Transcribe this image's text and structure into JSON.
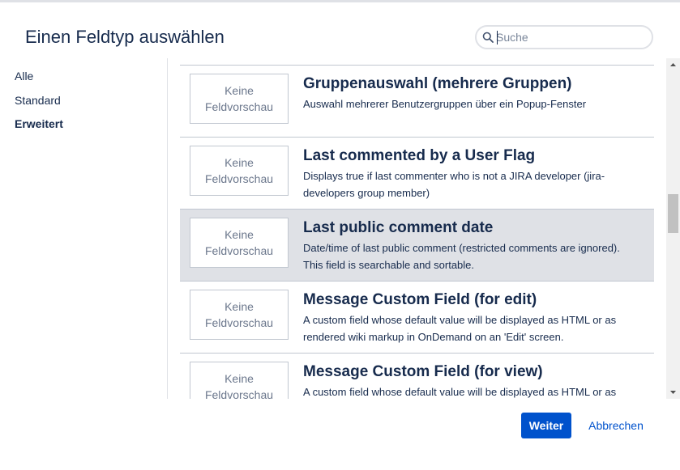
{
  "dialog": {
    "title": "Einen Feldtyp auswählen"
  },
  "search": {
    "placeholder": "Suche",
    "value": "",
    "icon": "search-icon"
  },
  "nav": {
    "items": [
      {
        "label": "Alle",
        "active": false
      },
      {
        "label": "Standard",
        "active": false
      },
      {
        "label": "Erweitert",
        "active": true
      }
    ]
  },
  "fields": [
    {
      "preview": "Keine Feldvorschau",
      "title": "Gruppenauswahl (mehrere Gruppen)",
      "description": "Auswahl mehrerer Benutzergruppen über ein Popup-Fenster",
      "selected": false
    },
    {
      "preview": "Keine Feldvorschau",
      "title": "Last commented by a User Flag",
      "description": "Displays true if last commenter who is not a JIRA developer (jira-developers group member)",
      "selected": false
    },
    {
      "preview": "Keine Feldvorschau",
      "title": "Last public comment date",
      "description": "Date/time of last public comment (restricted comments are ignored). This field is searchable and sortable.",
      "selected": true
    },
    {
      "preview": "Keine Feldvorschau",
      "title": "Message Custom Field (for edit)",
      "description": "A custom field whose default value will be displayed as HTML or as rendered wiki markup in OnDemand on an 'Edit' screen.",
      "selected": false
    },
    {
      "preview": "Keine Feldvorschau",
      "title": "Message Custom Field (for view)",
      "description": "A custom field whose default value will be displayed as HTML or as rendered wiki markup in OnDemand on a 'View' screen.",
      "selected": false
    }
  ],
  "footer": {
    "next_label": "Weiter",
    "cancel_label": "Abbrechen"
  },
  "colors": {
    "primary": "#0052cc",
    "selected_row": "#dfe1e6",
    "text": "#172b4d"
  }
}
